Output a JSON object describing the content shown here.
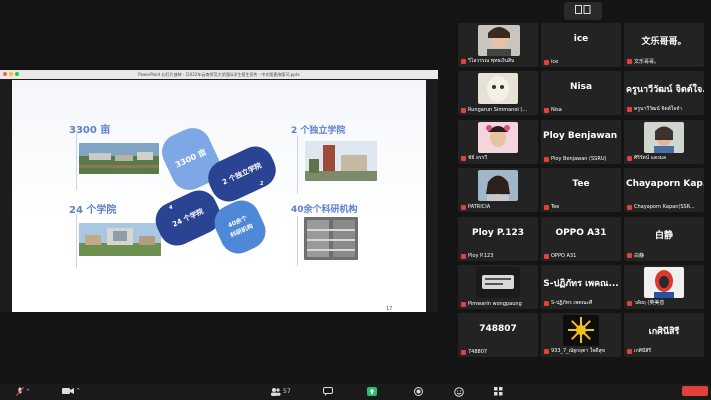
{
  "top_button": {
    "label": "▭▭"
  },
  "share": {
    "window_title": "PowerPoint 幻灯片放映 - [2022年云南师范大学国际学生招生宣传 - 中文版更改版3].pptx",
    "slide": {
      "stat_1": "3300 亩",
      "stat_2": "2 个独立学院",
      "stat_3": "24 个学院",
      "stat_4": "40余个科研机构",
      "pill_1": "3300 亩",
      "pill_2": "2 个独立学院",
      "pill_3": "24 个学院",
      "pill_4": "40余个\n科研机构",
      "pill_2_num": "2",
      "pill_3_num": "4",
      "page_number": "17"
    }
  },
  "participants": [
    {
      "big": "",
      "caption": "วิไลวรรณ พุทธเงินสิน",
      "video": true
    },
    {
      "big": "ice",
      "caption": "ice",
      "video": false
    },
    {
      "big": "文乐哥哥。",
      "caption": "文乐哥哥。",
      "video": false
    },
    {
      "big": "",
      "caption": "Rungarun Simmanoi (...",
      "video": true
    },
    {
      "big": "Nisa",
      "caption": "Nisa",
      "video": false
    },
    {
      "big": "ครูนาวีวัฒน์ จิตต์ใจ...",
      "caption": "ครูนาวีวัฒน์ จิตต์ใจจำ",
      "video": false
    },
    {
      "big": "",
      "caption": "ชัย์ อรรวี",
      "video": true
    },
    {
      "big": "Ploy Benjawan (...",
      "caption": "Ploy Benjawan (SSRU)",
      "video": false
    },
    {
      "big": "",
      "caption": "ศิริรัตน์ แตงมล",
      "video": true
    },
    {
      "big": "",
      "caption": "PATRICIA",
      "video": true
    },
    {
      "big": "Tee",
      "caption": "Tee",
      "video": false
    },
    {
      "big": "Chayaporn Kap...",
      "caption": "Chayaporn Kapan(SSR...",
      "video": false
    },
    {
      "big": "Ploy P.123",
      "caption": "Ploy P.123",
      "video": false
    },
    {
      "big": "OPPO A31",
      "caption": "OPPO A31",
      "video": false
    },
    {
      "big": "白静",
      "caption": "白静",
      "video": false
    },
    {
      "big": "",
      "caption": "Pimwarin wongpaung",
      "video": true
    },
    {
      "big": "S-ปฏิภัทร เพคณ...",
      "caption": "S-ปฏิภัทร เพคณะศี",
      "video": false
    },
    {
      "big": "",
      "caption": "วลัยฤ (英美音",
      "video": true
    },
    {
      "big": "748807",
      "caption": "748807",
      "video": false
    },
    {
      "big": "",
      "caption": "933_7_ณัฐกฤตา ใจดีสุข",
      "video": true
    },
    {
      "big": "เกศินีสิรี",
      "caption": "เกศินีสิรี",
      "video": false
    }
  ],
  "toolbar": {
    "participants_count": "57"
  }
}
